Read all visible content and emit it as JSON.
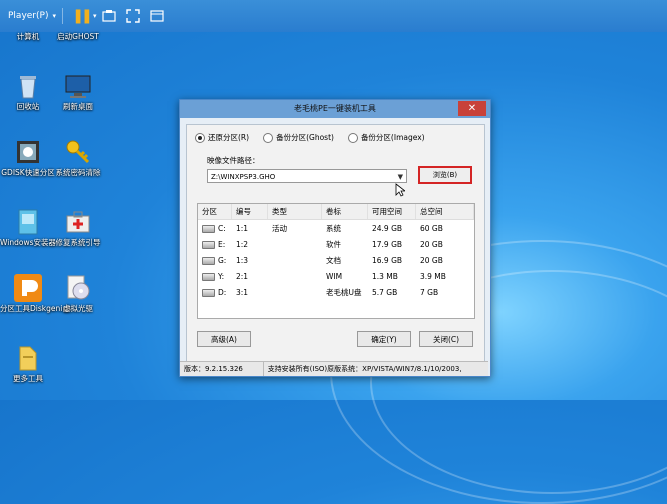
{
  "player": {
    "menu_label": "Player(P)"
  },
  "desktop": {
    "icons": [
      {
        "label": "计算机"
      },
      {
        "label": "启动GHOST"
      },
      {
        "label": "回收站"
      },
      {
        "label": "刷新桌面"
      },
      {
        "label": "GDISK快速分区"
      },
      {
        "label": "系统密码清除"
      },
      {
        "label": "Windows安装器"
      },
      {
        "label": "修复系统引导"
      },
      {
        "label": "分区工具Diskgenius"
      },
      {
        "label": "虚拟光驱"
      },
      {
        "label": "更多工具"
      }
    ]
  },
  "dialog": {
    "title": "老毛桃PE一键装机工具",
    "close_label": "✕",
    "radios": [
      {
        "label": "还原分区(R)",
        "checked": true
      },
      {
        "label": "备份分区(Ghost)",
        "checked": false
      },
      {
        "label": "备份分区(Imagex)",
        "checked": false
      }
    ],
    "image_path_label": "映像文件路径：",
    "image_path_value": "Z:\\WINXPSP3.GHO",
    "browse_label": "浏览(B)",
    "table": {
      "columns": [
        "分区",
        "编号",
        "类型",
        "卷标",
        "可用空间",
        "总空间"
      ],
      "rows": [
        [
          "C:",
          "1:1",
          "活动",
          "系统",
          "24.9 GB",
          "60 GB"
        ],
        [
          "E:",
          "1:2",
          "",
          "软件",
          "17.9 GB",
          "20 GB"
        ],
        [
          "G:",
          "1:3",
          "",
          "文档",
          "16.9 GB",
          "20 GB"
        ],
        [
          "Y:",
          "2:1",
          "",
          "WIM",
          "1.3 MB",
          "3.9 MB"
        ],
        [
          "D:",
          "3:1",
          "",
          "老毛桃U盘",
          "5.7 GB",
          "7 GB"
        ]
      ]
    },
    "advanced_label": "高级(A)",
    "ok_label": "确定(Y)",
    "cancel_label": "关闭(C)",
    "status": {
      "version": "版本：9.2.15.326",
      "support": "支持安装所有(ISO)原版系统：XP/VISTA/WIN7/8.1/10/2003,"
    }
  }
}
